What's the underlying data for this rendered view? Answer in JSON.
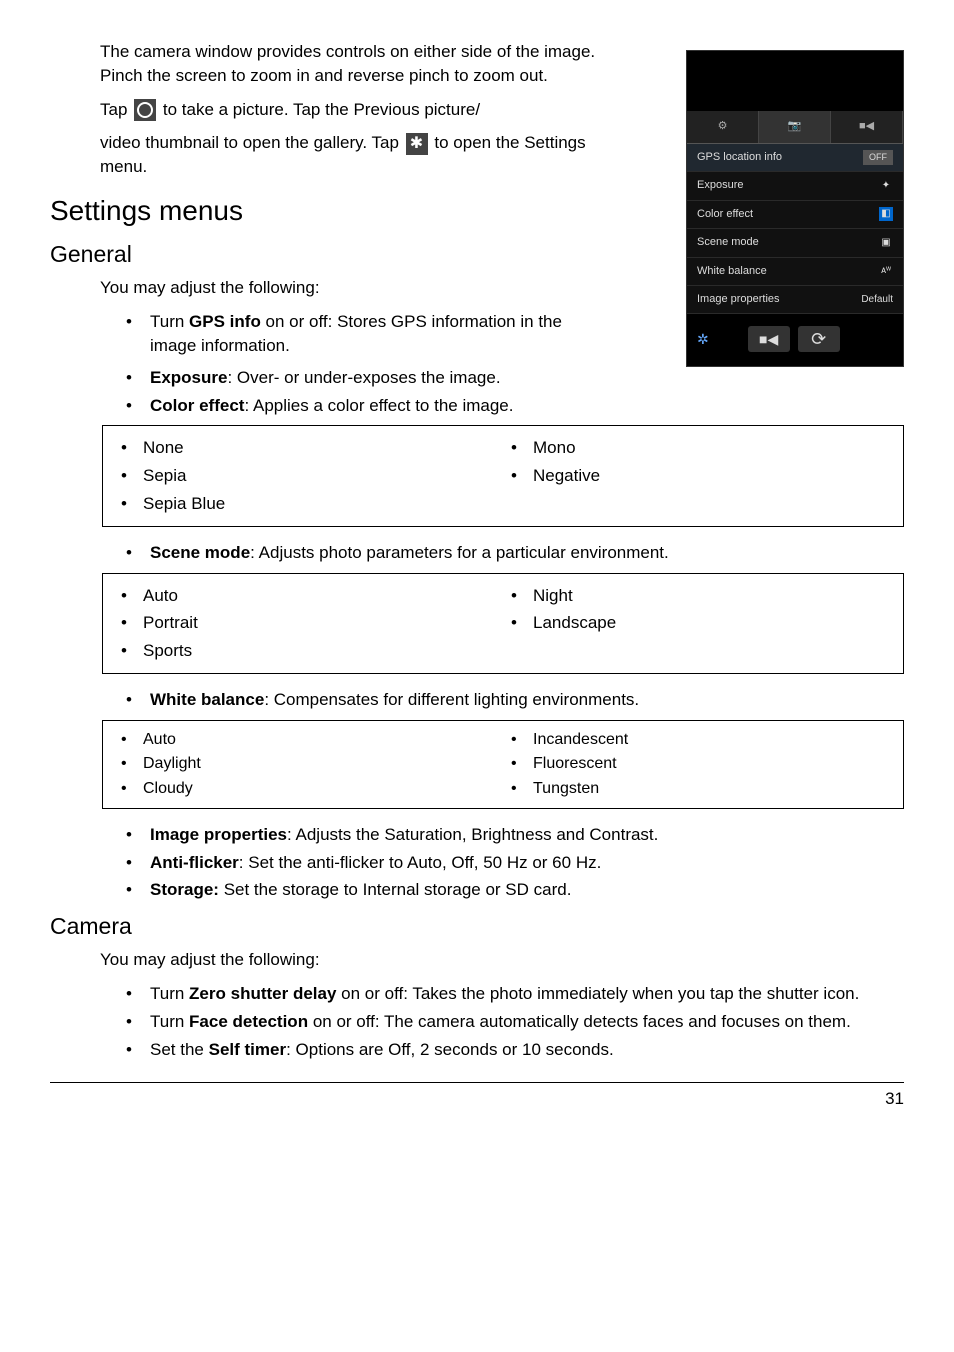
{
  "intro": {
    "p1": "The camera window provides controls on either side of the image. Pinch the screen to zoom in and reverse pinch to zoom out.",
    "p2a": "Tap ",
    "p2b": " to take a picture. Tap the Previous picture/",
    "p3a": "video thumbnail to open the gallery. Tap ",
    "p3b": " to open the Settings menu."
  },
  "h2_settings": "Settings menus",
  "h3_general": "General",
  "general_lead": "You may adjust the following:",
  "general_bullets": {
    "gps_a": "Turn ",
    "gps_b": "GPS info",
    "gps_c": " on or off: Stores GPS information in the image information.",
    "exposure_a": "Exposure",
    "exposure_b": ": Over- or under-exposes the image.",
    "color_a": "Color effect",
    "color_b": ": Applies a color effect to the image."
  },
  "color_opts_left": [
    "None",
    "Sepia",
    "Sepia Blue"
  ],
  "color_opts_right": [
    "Mono",
    "Negative"
  ],
  "scene_a": "Scene mode",
  "scene_b": ": Adjusts photo parameters for a particular environment.",
  "scene_opts_left": [
    "Auto",
    "Portrait",
    "Sports"
  ],
  "scene_opts_right": [
    "Night",
    "Landscape"
  ],
  "wb_a": "White balance",
  "wb_b": ": Compensates for different lighting environments.",
  "wb_opts_left": [
    "Auto",
    "Daylight",
    "Cloudy"
  ],
  "wb_opts_right": [
    "Incandescent",
    "Fluorescent",
    "Tungsten"
  ],
  "tail_bullets": {
    "ip_a": "Image properties",
    "ip_b": ": Adjusts the Saturation, Brightness and Contrast.",
    "af_a": "Anti-flicker",
    "af_b": ": Set the anti-flicker to Auto, Off, 50 Hz or 60 Hz.",
    "st_a": "Storage:",
    "st_b": " Set the storage to Internal storage or SD card."
  },
  "h3_camera": "Camera",
  "camera_lead": "You may adjust the following:",
  "camera_bullets": {
    "zsd_a": "Turn ",
    "zsd_b": "Zero shutter delay",
    "zsd_c": " on or off: Takes the photo immediately when you tap the shutter icon.",
    "fd_a": "Turn ",
    "fd_b": "Face detection",
    "fd_c": " on or off: The camera automatically detects faces and focuses on them.",
    "st_a": "Set the ",
    "st_b": "Self timer",
    "st_c": ": Options are Off, 2 seconds or 10 seconds."
  },
  "page_number": "31",
  "screenshot": {
    "rows": {
      "gps": "GPS location info",
      "gps_badge": "OFF",
      "exposure": "Exposure",
      "color": "Color effect",
      "scene": "Scene mode",
      "wb": "White balance",
      "ip": "Image properties",
      "ip_right": "Default"
    }
  }
}
